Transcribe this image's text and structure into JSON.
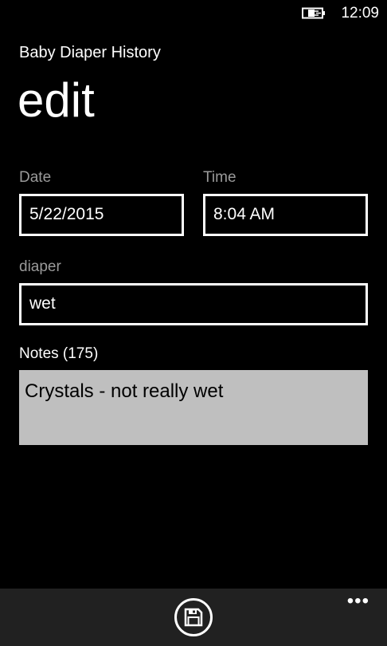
{
  "status_bar": {
    "time": "12:09",
    "battery_icon": "battery-charging-icon"
  },
  "header": {
    "app_title": "Baby Diaper History",
    "page_title": "edit"
  },
  "form": {
    "date_label": "Date",
    "date_value": "5/22/2015",
    "time_label": "Time",
    "time_value": "8:04 AM",
    "diaper_label": "diaper",
    "diaper_value": "wet",
    "notes_label": "Notes (175)",
    "notes_value": "Crystals - not really wet"
  },
  "app_bar": {
    "save_icon": "save-icon",
    "more_label": "•••"
  },
  "colors": {
    "background": "#000000",
    "label_gray": "#9a9a9a",
    "notes_bg": "#bfbfbf",
    "app_bar_bg": "#212121"
  }
}
